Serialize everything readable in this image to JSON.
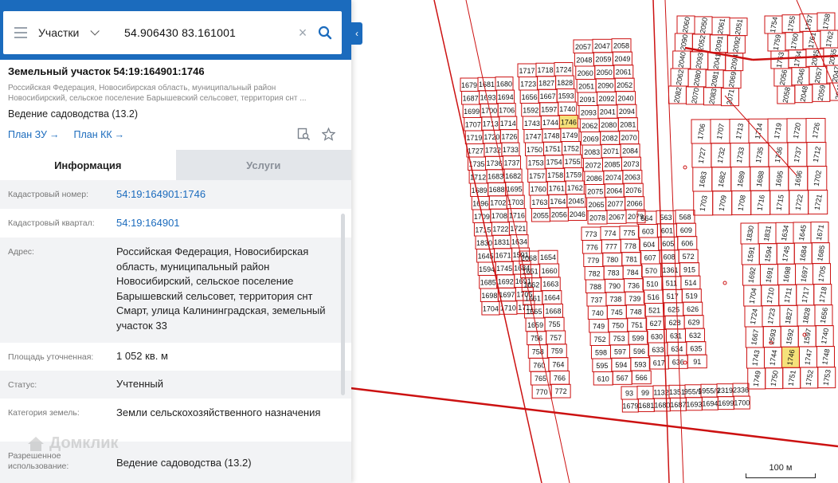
{
  "search": {
    "layer": "Участки",
    "query": "54.906430 83.161001"
  },
  "parcel": {
    "title": "Земельный участок 54:19:164901:1746",
    "address_short": "Российская Федерация, Новосибирская область, муниципальный район Новосибирский, сельское поселение Барышевский сельсовет, территория снт ...",
    "use": "Ведение садоводства (13.2)",
    "links": [
      "План ЗУ",
      "План КК"
    ]
  },
  "tabs": [
    "Информация",
    "Услуги"
  ],
  "info": [
    {
      "label": "Кадастровый номер:",
      "value": "54:19:164901:1746",
      "link": true
    },
    {
      "label": "Кадастровый квартал:",
      "value": "54:19:164901",
      "link": true
    },
    {
      "label": "Адрес:",
      "value": "Российская Федерация, Новосибирская область, муниципальный район Новосибирский, сельское поселение Барышевский сельсовет, территория снт Смарт, улица Калининградская, земельный участок 33",
      "link": false
    },
    {
      "label": "Площадь уточненная:",
      "value": "1 052 кв. м",
      "link": false
    },
    {
      "label": "Статус:",
      "value": "Учтенный",
      "link": false
    },
    {
      "label": "Категория земель:",
      "value": "Земли сельскохозяйственного назначения",
      "link": false
    },
    {
      "label": "Разрешенное использование:",
      "value": "Ведение садоводства (13.2)",
      "link": false
    }
  ],
  "watermark": "Домклик",
  "map": {
    "scale_label": "100 м",
    "highlight_parcel": "1746",
    "line_color": "#cc1111",
    "highlight_color": "#f5e27a",
    "parcels": [
      "1679",
      "1681",
      "1680",
      "1687",
      "1693",
      "1694",
      "1699",
      "1700",
      "1706",
      "1707",
      "1713",
      "1714",
      "1719",
      "1720",
      "1726",
      "1727",
      "1732",
      "1733",
      "1735",
      "1736",
      "1737",
      "1712",
      "1683",
      "1682",
      "1689",
      "1688",
      "1695",
      "1696",
      "1702",
      "1703",
      "1709",
      "1708",
      "1716",
      "1715",
      "1722",
      "1721",
      "1830",
      "1831",
      "1634",
      "1645",
      "1671",
      "1591",
      "1594",
      "1745",
      "1684",
      "1685",
      "1692",
      "1691",
      "1698",
      "1697",
      "1705",
      "1704",
      "1710",
      "1711",
      "1717",
      "1718",
      "1724",
      "1723",
      "1827",
      "1828",
      "1656",
      "1667",
      "1593",
      "1592",
      "1597",
      "1740",
      "1743",
      "1744",
      "1746",
      "1747",
      "1748",
      "1749",
      "1750",
      "1751",
      "1752",
      "1753",
      "1754",
      "1755",
      "1757",
      "1758",
      "1759",
      "1760",
      "1761",
      "1762",
      "1763",
      "1764",
      "2045",
      "2055",
      "2056",
      "2046",
      "2057",
      "2047",
      "2058",
      "2048",
      "2059",
      "2049",
      "2060",
      "2050",
      "2061",
      "2051",
      "2090",
      "2052",
      "2091",
      "2092",
      "2040",
      "2093",
      "2041",
      "2094",
      "2062",
      "2080",
      "2081",
      "2069",
      "2082",
      "2070",
      "2083",
      "2071",
      "2084",
      "2072",
      "2085",
      "2073",
      "2086",
      "2074",
      "2063",
      "2075",
      "2064",
      "2076",
      "2065",
      "2077",
      "2066",
      "2078",
      "2067",
      "2079",
      "2068",
      "1654",
      "1651",
      "1660",
      "1662",
      "1663",
      "1661",
      "1664",
      "1665",
      "1668",
      "1659",
      "755",
      "756",
      "757",
      "758",
      "759",
      "760",
      "764",
      "765",
      "766",
      "770",
      "772",
      "773",
      "774",
      "775",
      "776",
      "777",
      "778",
      "779",
      "780",
      "781",
      "782",
      "783",
      "784",
      "788",
      "790",
      "736",
      "737",
      "738",
      "739",
      "740",
      "745",
      "748",
      "749",
      "750",
      "751",
      "752",
      "753",
      "599",
      "598",
      "597",
      "596",
      "595",
      "594",
      "593",
      "610",
      "567",
      "566",
      "564",
      "563",
      "568",
      "603",
      "601",
      "609",
      "604",
      "605",
      "606",
      "607",
      "608",
      "572",
      "570",
      "1361",
      "915",
      "510",
      "511",
      "514",
      "516",
      "517",
      "519",
      "521",
      "625",
      "626",
      "627",
      "628",
      "629",
      "630",
      "631",
      "632",
      "633",
      "634",
      "635",
      "617",
      "636",
      "91",
      "93",
      "99",
      "1132",
      "1351",
      "955/9",
      "1955/9",
      "2319",
      "2336"
    ]
  }
}
